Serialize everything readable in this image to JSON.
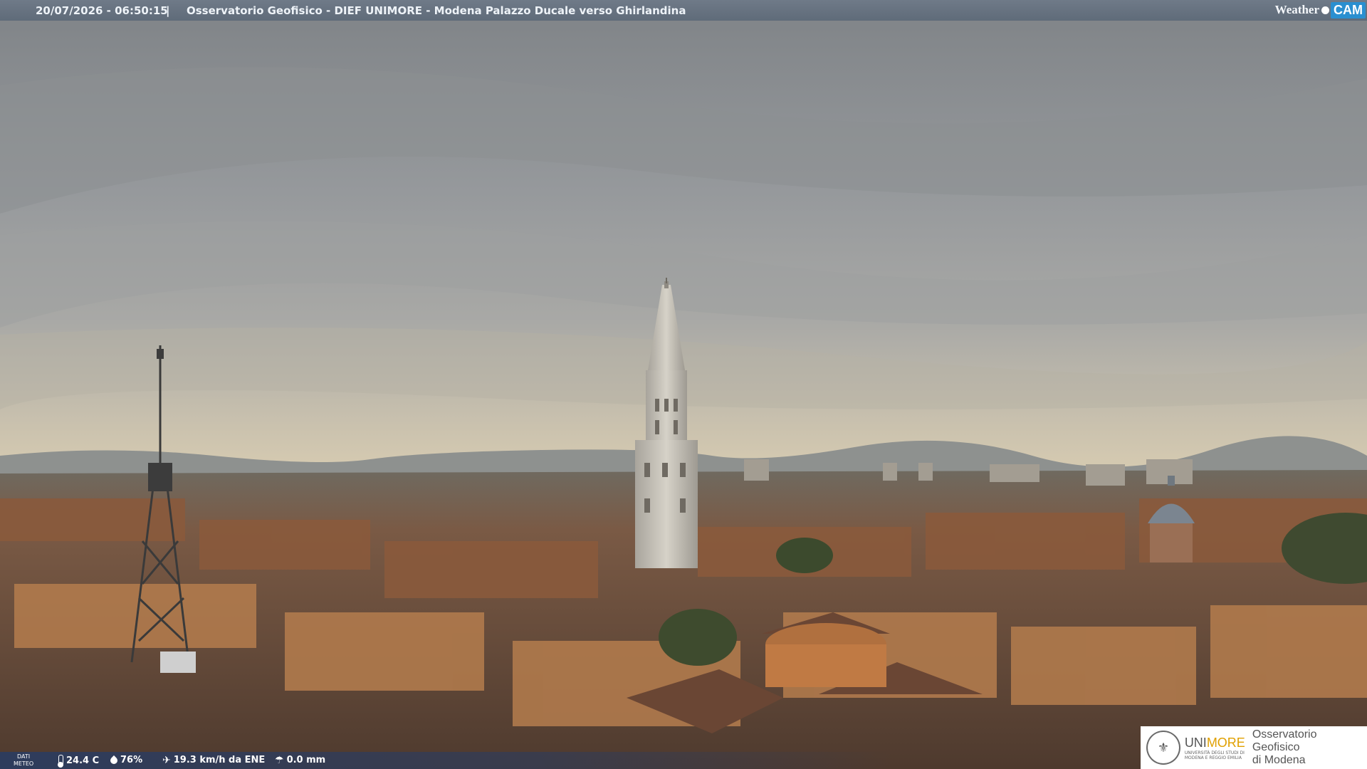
{
  "overlay": {
    "datetime": "20/07/2026 - 06:50:15",
    "separator": "|",
    "caption": "Osservatorio Geofisico - DIEF UNIMORE - Modena Palazzo Ducale verso Ghirlandina",
    "brand_weather": "Weather",
    "brand_cam": "CAM"
  },
  "meteo": {
    "label_line1": "DATI",
    "label_line2": "METEO",
    "temperature": "24.4 C",
    "humidity": "76%",
    "wind": "19.3 km/h da ENE",
    "rain": "0.0 mm",
    "icons": [
      "thermometer-icon",
      "humidity-drop-icon",
      "wind-icon",
      "rain-icon"
    ]
  },
  "logo": {
    "name_part1": "UNI",
    "name_part2": "MORE",
    "university_line1": "UNIVERSITÀ DEGLI STUDI DI",
    "university_line2": "MODENA E REGGIO EMILIA",
    "observatory_line1": "Osservatorio Geofisico",
    "observatory_line2": "di Modena",
    "accent": "#e0a000"
  }
}
